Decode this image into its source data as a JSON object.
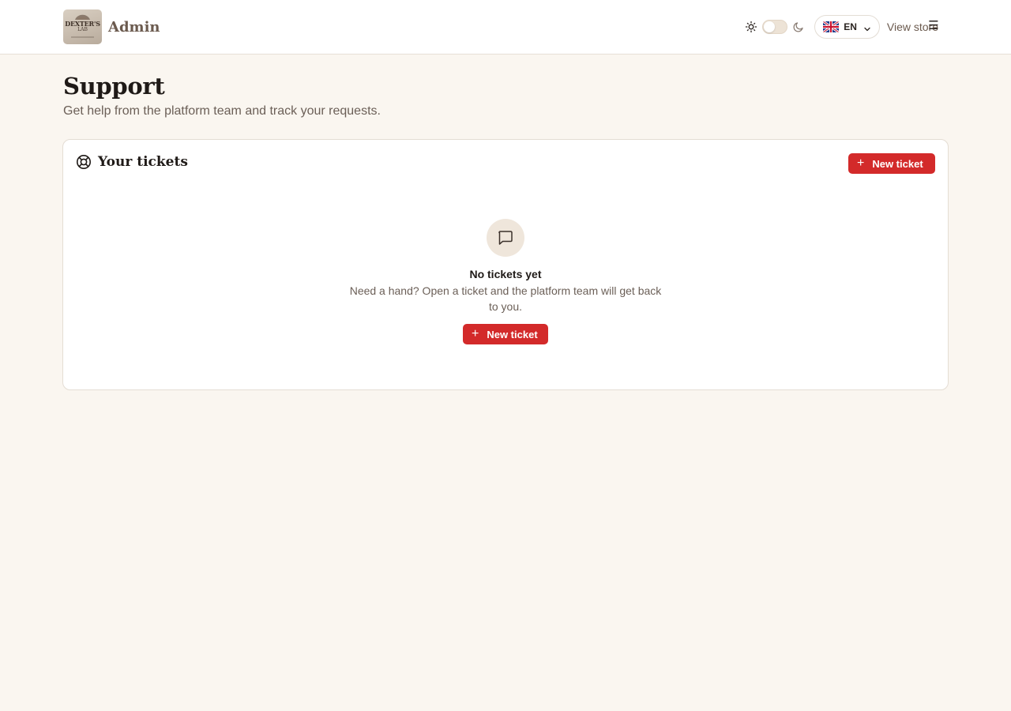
{
  "header": {
    "logo_text": "DEXTER'S",
    "logo_sub": "LAB",
    "brand_title": "Admin",
    "language": {
      "code": "EN",
      "flag": "uk-flag-icon"
    },
    "view_store_label": "View store",
    "menu_icon": "☰",
    "theme": {
      "mode": "light",
      "sun_icon": "sun-icon",
      "moon_icon": "moon-icon"
    }
  },
  "page": {
    "title": "Support",
    "subtitle": "Get help from the platform team and track your requests."
  },
  "tickets_card": {
    "title": "Your tickets",
    "title_icon": "lifebuoy-icon",
    "new_ticket_label": "New ticket",
    "plus_glyph": "+",
    "empty_state": {
      "icon": "message-square-icon",
      "title": "No tickets yet",
      "description": "Need a hand? Open a ticket and the platform team will get back to you.",
      "button_label": "New ticket"
    }
  },
  "colors": {
    "background": "#faf6f0",
    "accent": "#d32a2a",
    "header_bg": "#ffffff",
    "muted_text": "#6b5f57"
  }
}
